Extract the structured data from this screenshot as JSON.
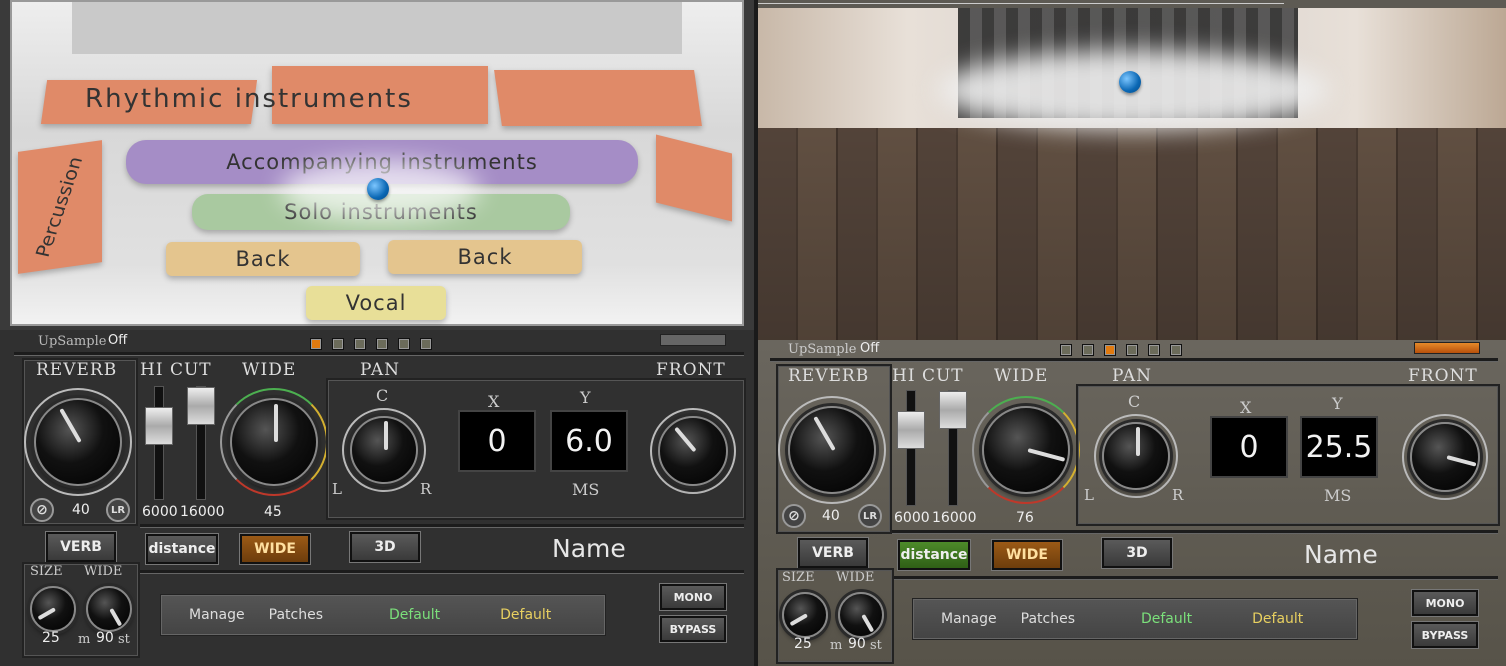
{
  "panels": [
    {
      "stage_kind": "zones",
      "zones": {
        "rhythmic": "Rhythmic instruments",
        "accompanying": "Accompanying instruments",
        "solo": "Solo instruments",
        "back_left": "Back",
        "back_right": "Back",
        "vocal": "Vocal",
        "percussion": "Percussion"
      },
      "upsample": {
        "label": "UpSample",
        "value": "Off"
      },
      "page_leds": [
        true,
        false,
        false,
        false,
        false,
        false
      ],
      "reverb": {
        "label": "REVERB",
        "value": "40",
        "lr": "LR",
        "phase": "⊘"
      },
      "hicut": {
        "label": "HI CUT",
        "left": "6000",
        "right": "16000"
      },
      "wide": {
        "label": "WIDE",
        "value": "45"
      },
      "pan": {
        "label": "PAN",
        "c": "C",
        "l": "L",
        "r": "R"
      },
      "x": {
        "label": "X",
        "value": "0"
      },
      "y": {
        "label": "Y",
        "value": "6.0"
      },
      "ms": "MS",
      "front": {
        "label": "FRONT"
      },
      "buttons": {
        "verb": "VERB",
        "distance": "distance",
        "wide": "WIDE",
        "three_d": "3D",
        "mono": "MONO",
        "bypass": "BYPASS"
      },
      "name": "Name",
      "size": {
        "label": "SIZE",
        "value": "25"
      },
      "wide2": {
        "label": "WIDE",
        "value": "90",
        "m": "m",
        "st": "st"
      },
      "patch": {
        "manage": "Manage",
        "patches": "Patches",
        "default1": "Default",
        "default2": "Default"
      },
      "distance_on": false,
      "meter_on": false
    },
    {
      "stage_kind": "room",
      "upsample": {
        "label": "UpSample",
        "value": "Off"
      },
      "page_leds": [
        false,
        false,
        true,
        false,
        false,
        false
      ],
      "reverb": {
        "label": "REVERB",
        "value": "40",
        "lr": "LR",
        "phase": "⊘"
      },
      "hicut": {
        "label": "HI CUT",
        "left": "6000",
        "right": "16000"
      },
      "wide": {
        "label": "WIDE",
        "value": "76"
      },
      "pan": {
        "label": "PAN",
        "c": "C",
        "l": "L",
        "r": "R"
      },
      "x": {
        "label": "X",
        "value": "0"
      },
      "y": {
        "label": "Y",
        "value": "25.5"
      },
      "ms": "MS",
      "front": {
        "label": "FRONT"
      },
      "buttons": {
        "verb": "VERB",
        "distance": "distance",
        "wide": "WIDE",
        "three_d": "3D",
        "mono": "MONO",
        "bypass": "BYPASS"
      },
      "name": "Name",
      "size": {
        "label": "SIZE",
        "value": "25"
      },
      "wide2": {
        "label": "WIDE",
        "value": "90",
        "m": "m",
        "st": "st"
      },
      "patch": {
        "manage": "Manage",
        "patches": "Patches",
        "default1": "Default",
        "default2": "Default"
      },
      "distance_on": true,
      "meter_on": true
    }
  ],
  "colors": {
    "accent_green": "#7be07b",
    "accent_yellow": "#e8d060",
    "led_on": "#e07a10"
  }
}
